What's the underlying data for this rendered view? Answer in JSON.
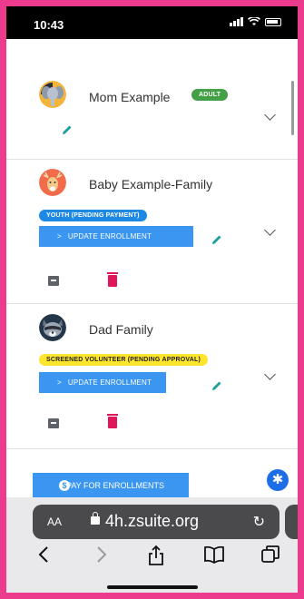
{
  "status_bar": {
    "time": "10:43"
  },
  "members": [
    {
      "name": "Mom Example",
      "badge": "ADULT",
      "avatar_icon": "elephant-avatar"
    },
    {
      "name": "Baby Example-Family",
      "badge": "YOUTH (PENDING PAYMENT)",
      "action": "UPDATE ENROLLMENT",
      "avatar_icon": "deer-avatar"
    },
    {
      "name": "Dad Family",
      "badge": "SCREENED VOLUNTEER (PENDING APPROVAL)",
      "action": "UPDATE ENROLLMENT",
      "avatar_icon": "raccoon-avatar"
    }
  ],
  "pay_button": {
    "label": "PAY FOR ENROLLMENTS",
    "icon": "dollar-icon"
  },
  "accessibility": {
    "icon": "accessibility-icon"
  },
  "browser": {
    "text_size": "AA",
    "url": "4h.zsuite.org",
    "icons": [
      "back-icon",
      "forward-icon",
      "share-icon",
      "bookmarks-icon",
      "tabs-icon"
    ]
  },
  "colors": {
    "frame": "#ec3a8c",
    "primary_button": "#3a96f0",
    "adult_badge": "#43a047",
    "youth_badge": "#1e88e5",
    "volunteer_badge": "#ffe52c",
    "delete": "#e0165a",
    "edit": "#1aa0a0"
  }
}
